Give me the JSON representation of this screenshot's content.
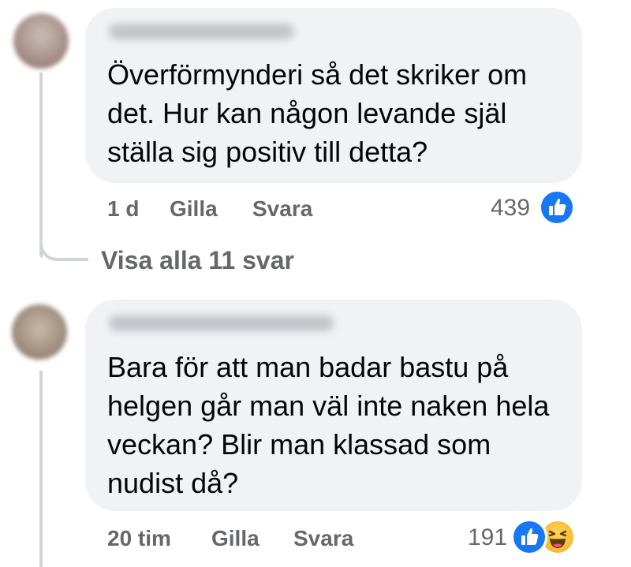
{
  "comments": [
    {
      "text": "Överförmynderi så det skriker om det. Hur kan någon levande själ ställa sig positiv till detta?",
      "age": "1 d",
      "like_label": "Gilla",
      "reply_label": "Svara",
      "reaction_count": "439",
      "reactions": [
        "like-icon"
      ]
    },
    {
      "text": "Bara för att man badar bastu på helgen går man väl inte naken hela veckan? Blir man klassad som nudist då?",
      "age": "20 tim",
      "like_label": "Gilla",
      "reply_label": "Svara",
      "reaction_count": "191",
      "reactions": [
        "like-icon",
        "haha-icon"
      ]
    }
  ],
  "view_replies": "Visa alla 11 svar",
  "colors": {
    "bubble": "#f0f2f5",
    "meta_text": "#65676b",
    "like_blue": "#1877f2",
    "haha_yellow": "#f7b125",
    "thread_line": "#d0d3d8"
  }
}
